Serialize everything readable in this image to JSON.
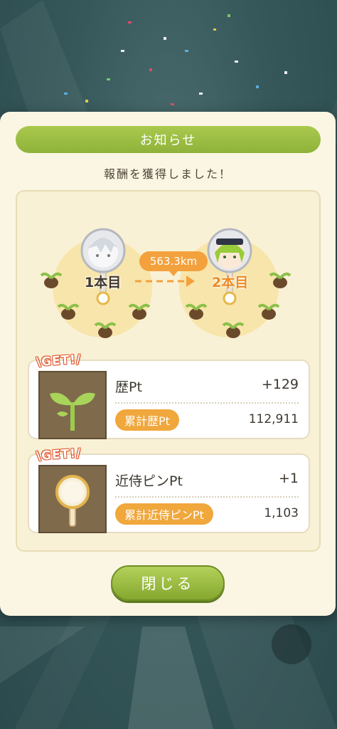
{
  "dialog": {
    "title": "お知らせ",
    "subtitle": "報酬を獲得しました！"
  },
  "progress": {
    "from_label": "1本目",
    "to_label": "2本目",
    "distance": "563.3km"
  },
  "rewards": [
    {
      "badge": "\\GET!/",
      "name": "歴Pt",
      "value": "+129",
      "total_label": "累計歴Pt",
      "total_value": "112,911",
      "icon": "sprout-icon"
    },
    {
      "badge": "\\GET!/",
      "name": "近侍ピンPt",
      "value": "+1",
      "total_label": "累計近侍ピンPt",
      "total_value": "1,103",
      "icon": "pin-icon"
    }
  ],
  "close_button": "閉じる",
  "colors": {
    "accent_green": "#9bbd43",
    "accent_orange": "#f0a73c",
    "panel_bg": "#fbf6e3"
  }
}
